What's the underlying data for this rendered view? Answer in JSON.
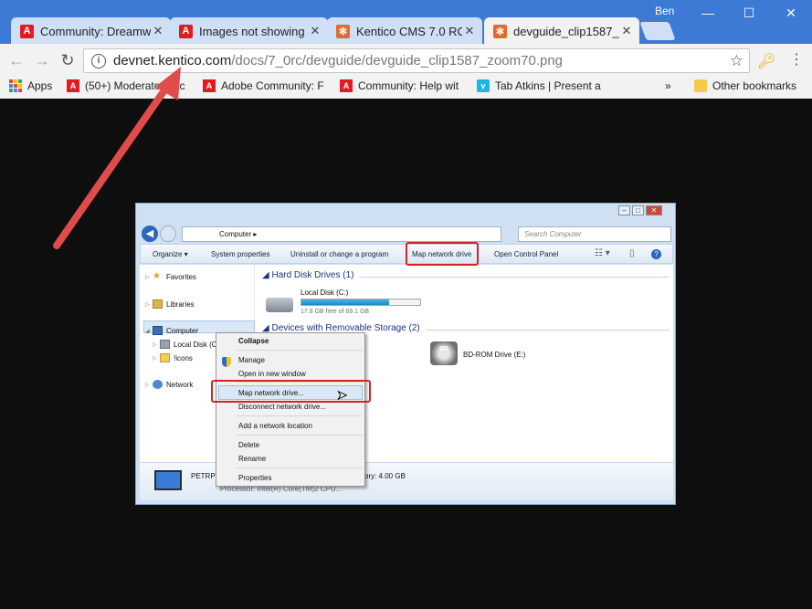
{
  "browser": {
    "profile_name": "Ben",
    "tabs": [
      {
        "title": "Community: Dreamw",
        "favicon": "adobe-icon",
        "active": false
      },
      {
        "title": "Images not showing",
        "favicon": "adobe-icon",
        "active": false
      },
      {
        "title": "Kentico CMS 7.0 RC I",
        "favicon": "kentico-icon",
        "active": false
      },
      {
        "title": "devguide_clip1587_z",
        "favicon": "kentico-icon",
        "active": true
      }
    ],
    "url_host": "devnet.kentico.com",
    "url_path": "/docs/7_0rc/devguide/devguide_clip1587_zoom70.png",
    "bookmarks": [
      {
        "label": "Apps",
        "icon": "apps-grid-icon"
      },
      {
        "label": "(50+) Moderator | Ac",
        "icon": "adobe-icon"
      },
      {
        "label": "Adobe Community: F",
        "icon": "adobe-icon"
      },
      {
        "label": "Community: Help wit",
        "icon": "adobe-icon"
      },
      {
        "label": "Tab Atkins | Present a",
        "icon": "vimeo-icon"
      }
    ],
    "more_bookmarks": "»",
    "other_bookmarks": "Other bookmarks"
  },
  "explorer": {
    "path": "Computer",
    "search_placeholder": "Search Computer",
    "commands": [
      "Organize ▾",
      "System properties",
      "Uninstall or change a program",
      "Map network drive",
      "Open Control Panel"
    ],
    "nav": {
      "favorites": "Favorites",
      "libraries": "Libraries",
      "computer": "Computer",
      "local_disk": "Local Disk (C:)",
      "icons": "!icons",
      "network": "Network"
    },
    "hard_disk_header": "Hard Disk Drives (1)",
    "local_disk_name": "Local Disk (C:)",
    "local_disk_free": "17.8 GB free of 69.1 GB",
    "usage_fraction": 0.74,
    "removable_header": "Devices with Removable Storage (2)",
    "bd_drive": "BD-ROM Drive (E:)",
    "bd_badge": "BD",
    "details_name": "PETRPE",
    "details_memory": "ory: 4.00 GB",
    "details_processor": "Processor: Intel(R) Core(TM)2 CPU..."
  },
  "context_menu": {
    "items": [
      "Collapse",
      "Manage",
      "Open in new window",
      "Map network drive...",
      "Disconnect network drive...",
      "Add a network location",
      "Delete",
      "Rename",
      "Properties"
    ]
  },
  "colors": {
    "browser_frame": "#3c7ad6",
    "highlight_red": "#d42424",
    "arrow_red": "#e04b4b",
    "page_background": "#0e0e0e"
  }
}
